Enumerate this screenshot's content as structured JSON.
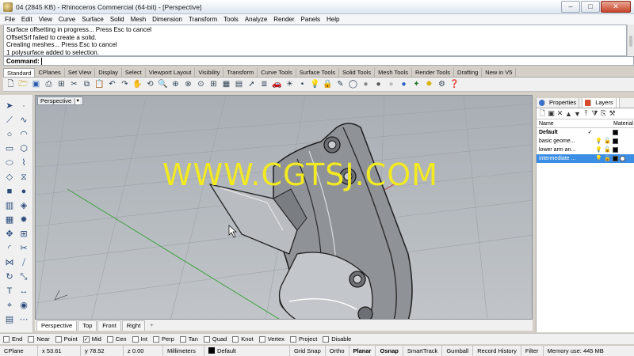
{
  "window": {
    "title": "04 (2845 KB) - Rhinoceros Commercial (64-bit) - [Perspective]",
    "minimize": "–",
    "maximize": "□",
    "close": "✕"
  },
  "menu": [
    "File",
    "Edit",
    "View",
    "Curve",
    "Surface",
    "Solid",
    "Mesh",
    "Dimension",
    "Transform",
    "Tools",
    "Analyze",
    "Render",
    "Panels",
    "Help"
  ],
  "command_history": [
    "Surface offsetting in progress... Press Esc to cancel",
    "OffsetSrf failed to create a solid.",
    "Creating meshes... Press Esc to cancel",
    "1 polysurface added to selection."
  ],
  "command": {
    "label": "Command:",
    "value": ""
  },
  "toolbar_tabs": [
    "Standard",
    "CPlanes",
    "Set View",
    "Display",
    "Select",
    "Viewport Layout",
    "Visibility",
    "Transform",
    "Curve Tools",
    "Surface Tools",
    "Solid Tools",
    "Mesh Tools",
    "Render Tools",
    "Drafting",
    "New in V5"
  ],
  "toolbar_icons": [
    "new-file-icon",
    "open-file-icon",
    "save-icon",
    "print-icon",
    "import-icon",
    "cut-icon",
    "copy-icon",
    "paste-icon",
    "undo-icon",
    "redo-icon",
    "pan-icon",
    "rotate-view-icon",
    "zoom-icon",
    "zoom-window-icon",
    "zoom-extents-icon",
    "zoom-selected-icon",
    "four-view-icon",
    "grid-icon",
    "named-view-icon",
    "select-icon",
    "layer-icon",
    "car-icon",
    "light-icon",
    "point-icon",
    "lightbulb-icon",
    "lock-icon",
    "properties-icon",
    "sphere-wire-icon",
    "sphere-shade-icon",
    "sphere-render-icon",
    "sphere-ghost-icon",
    "sphere-blue-icon",
    "render-icon",
    "light-bulb-icon",
    "options-icon",
    "help-icon"
  ],
  "viewport": {
    "title": "Perspective",
    "watermark": "WWW.CGTSJ.COM"
  },
  "view_tabs": [
    "Perspective",
    "Top",
    "Front",
    "Right",
    "+"
  ],
  "panel": {
    "tabs": [
      "Properties",
      "Layers"
    ],
    "columns": {
      "name": "Name",
      "material": "Material"
    },
    "layers": [
      {
        "name": "Default",
        "current": "✓",
        "bold": true,
        "selected": false
      },
      {
        "name": "basic geome...",
        "current": "",
        "bold": false,
        "selected": false
      },
      {
        "name": "lower arm an...",
        "current": "",
        "bold": false,
        "selected": false
      },
      {
        "name": "intermediate ...",
        "current": "",
        "bold": false,
        "selected": true
      }
    ]
  },
  "osnaps": [
    {
      "label": "End",
      "checked": false
    },
    {
      "label": "Near",
      "checked": false
    },
    {
      "label": "Point",
      "checked": false
    },
    {
      "label": "Mid",
      "checked": true
    },
    {
      "label": "Cen",
      "checked": false
    },
    {
      "label": "Int",
      "checked": false
    },
    {
      "label": "Perp",
      "checked": false
    },
    {
      "label": "Tan",
      "checked": false
    },
    {
      "label": "Quad",
      "checked": false
    },
    {
      "label": "Knot",
      "checked": false
    },
    {
      "label": "Vertex",
      "checked": false
    },
    {
      "label": "Project",
      "checked": false
    },
    {
      "label": "Disable",
      "checked": false
    }
  ],
  "status": {
    "cplane": "CPlane",
    "x": "x 53.61",
    "y": "y 78.52",
    "z": "z 0.00",
    "units": "Millimeters",
    "layer": "Default",
    "grid_snap": "Grid Snap",
    "ortho": "Ortho",
    "planar": "Planar",
    "osnap": "Osnap",
    "smarttrack": "SmartTrack",
    "gumball": "Gumball",
    "record_history": "Record History",
    "filter": "Filter",
    "memory": "Memory use: 445 MB"
  }
}
